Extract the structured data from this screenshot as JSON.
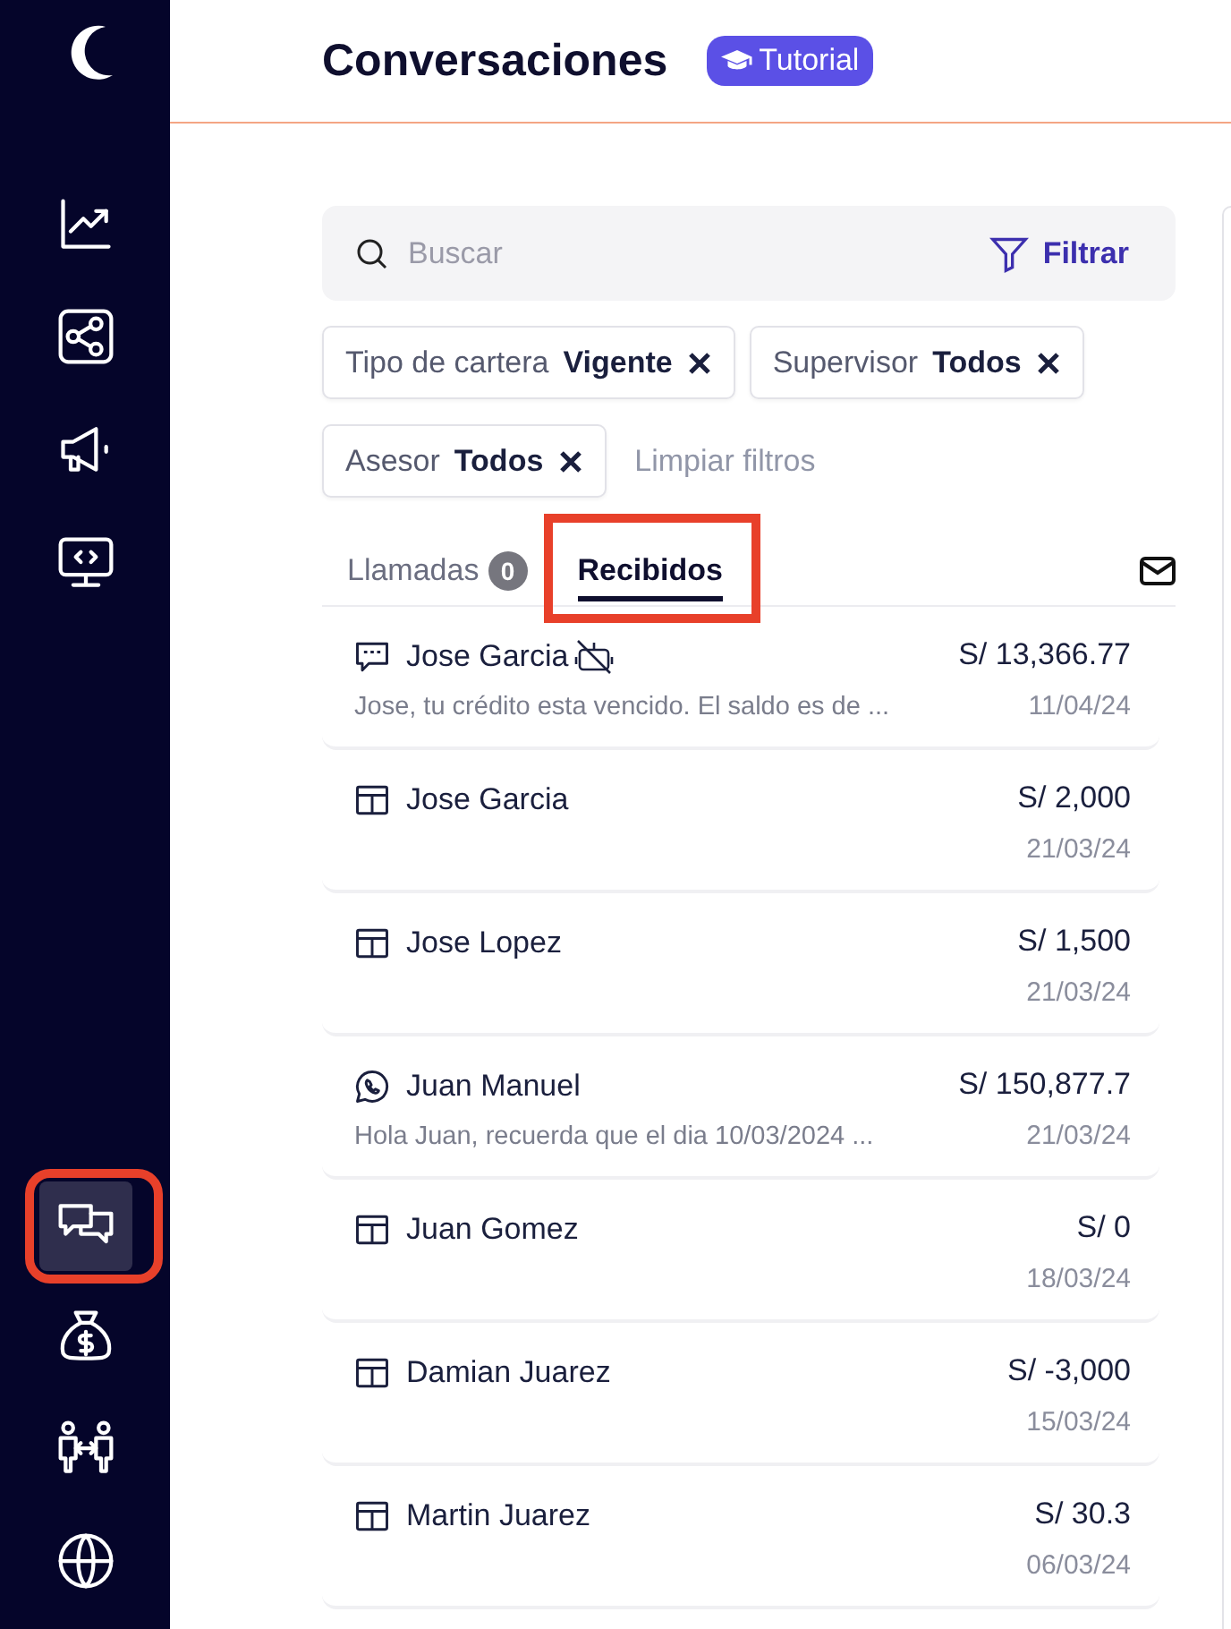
{
  "sidebar": {
    "items": [
      {
        "kind": "chart",
        "selected": false,
        "highlighted": false
      },
      {
        "kind": "share",
        "selected": false,
        "highlighted": false
      },
      {
        "kind": "megaphone",
        "selected": false,
        "highlighted": false
      },
      {
        "kind": "monitor",
        "selected": false,
        "highlighted": false
      },
      {
        "kind": "chat",
        "selected": true,
        "highlighted": true
      },
      {
        "kind": "money",
        "selected": false,
        "highlighted": false
      },
      {
        "kind": "people",
        "selected": false,
        "highlighted": false
      },
      {
        "kind": "globe",
        "selected": false,
        "highlighted": false
      }
    ]
  },
  "header": {
    "title": "Conversaciones",
    "tutorial_button": "Tutorial"
  },
  "search": {
    "placeholder": "Buscar",
    "filter_button": "Filtrar"
  },
  "filters": [
    {
      "label": "Tipo de cartera",
      "value": "Vigente"
    },
    {
      "label": "Supervisor",
      "value": "Todos"
    },
    {
      "label": "Asesor",
      "value": "Todos"
    }
  ],
  "clear_filters": "Limpiar filtros",
  "tabs": [
    {
      "label": "Llamadas",
      "count": "0",
      "selected": false,
      "highlighted": false
    },
    {
      "label": "Recibidos",
      "selected": true,
      "highlighted": true
    }
  ],
  "conversations": [
    {
      "kind": "sms",
      "name": "Jose Garcia",
      "bot_disabled": true,
      "amount": "S/ 13,366.77",
      "preview": "Jose, tu crédito esta vencido. El saldo es de ...",
      "date": "11/04/24"
    },
    {
      "kind": "table",
      "name": "Jose Garcia",
      "bot_disabled": false,
      "amount": "S/ 2,000",
      "date": "21/03/24"
    },
    {
      "kind": "table",
      "name": "Jose Lopez",
      "bot_disabled": false,
      "amount": "S/ 1,500",
      "date": "21/03/24"
    },
    {
      "kind": "whatsapp",
      "name": "Juan Manuel",
      "bot_disabled": false,
      "amount": "S/ 150,877.7",
      "preview": "Hola Juan, recuerda que el dia 10/03/2024 ...",
      "date": "21/03/24"
    },
    {
      "kind": "table",
      "name": "Juan Gomez",
      "bot_disabled": false,
      "amount": "S/ 0",
      "date": "18/03/24"
    },
    {
      "kind": "table",
      "name": "Damian Juarez",
      "bot_disabled": false,
      "amount": "S/ -3,000",
      "date": "15/03/24"
    },
    {
      "kind": "table",
      "name": "Martin Juarez",
      "bot_disabled": false,
      "amount": "S/ 30.3",
      "date": "06/03/24"
    }
  ]
}
